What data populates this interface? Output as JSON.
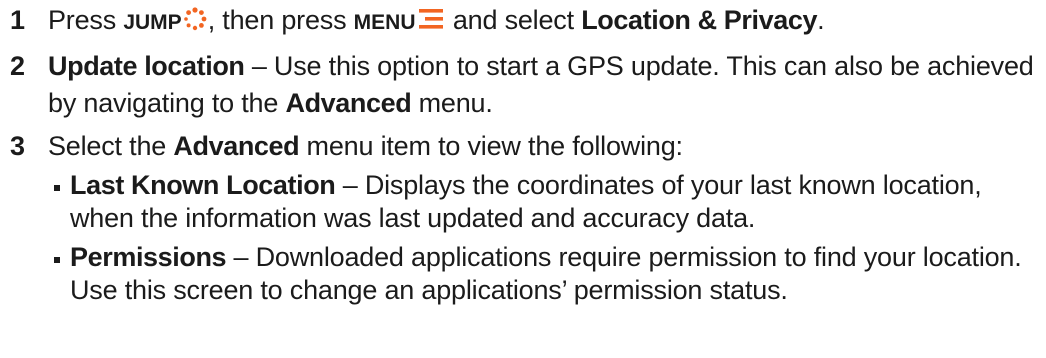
{
  "steps": [
    {
      "number": "1",
      "t1": "Press ",
      "jump": "JUMP",
      "t2": ", then press ",
      "menu": "MENU",
      "t3": " and select ",
      "target": "Location & Privacy",
      "t4": "."
    },
    {
      "number": "2",
      "title": "Update location",
      "t1": " – Use this option to start a GPS update. This can also be achieved by navigating to the ",
      "advanced": "Advanced",
      "t2": " menu."
    },
    {
      "number": "3",
      "t1": "Select the ",
      "advanced": "Advanced",
      "t2": " menu item to view the following:",
      "items": [
        {
          "title": "Last Known Location",
          "text": " – Displays the coordinates of your last known location, when the information was last updated and accuracy data."
        },
        {
          "title": "Permissions",
          "text": " – Downloaded applications require permission to find your location. Use this screen to change an applications’ permission status."
        }
      ]
    }
  ],
  "icons": {
    "jump": "jump-icon",
    "menu": "menu-icon"
  },
  "colors": {
    "accent": "#f26522",
    "text": "#1b1b1b"
  }
}
